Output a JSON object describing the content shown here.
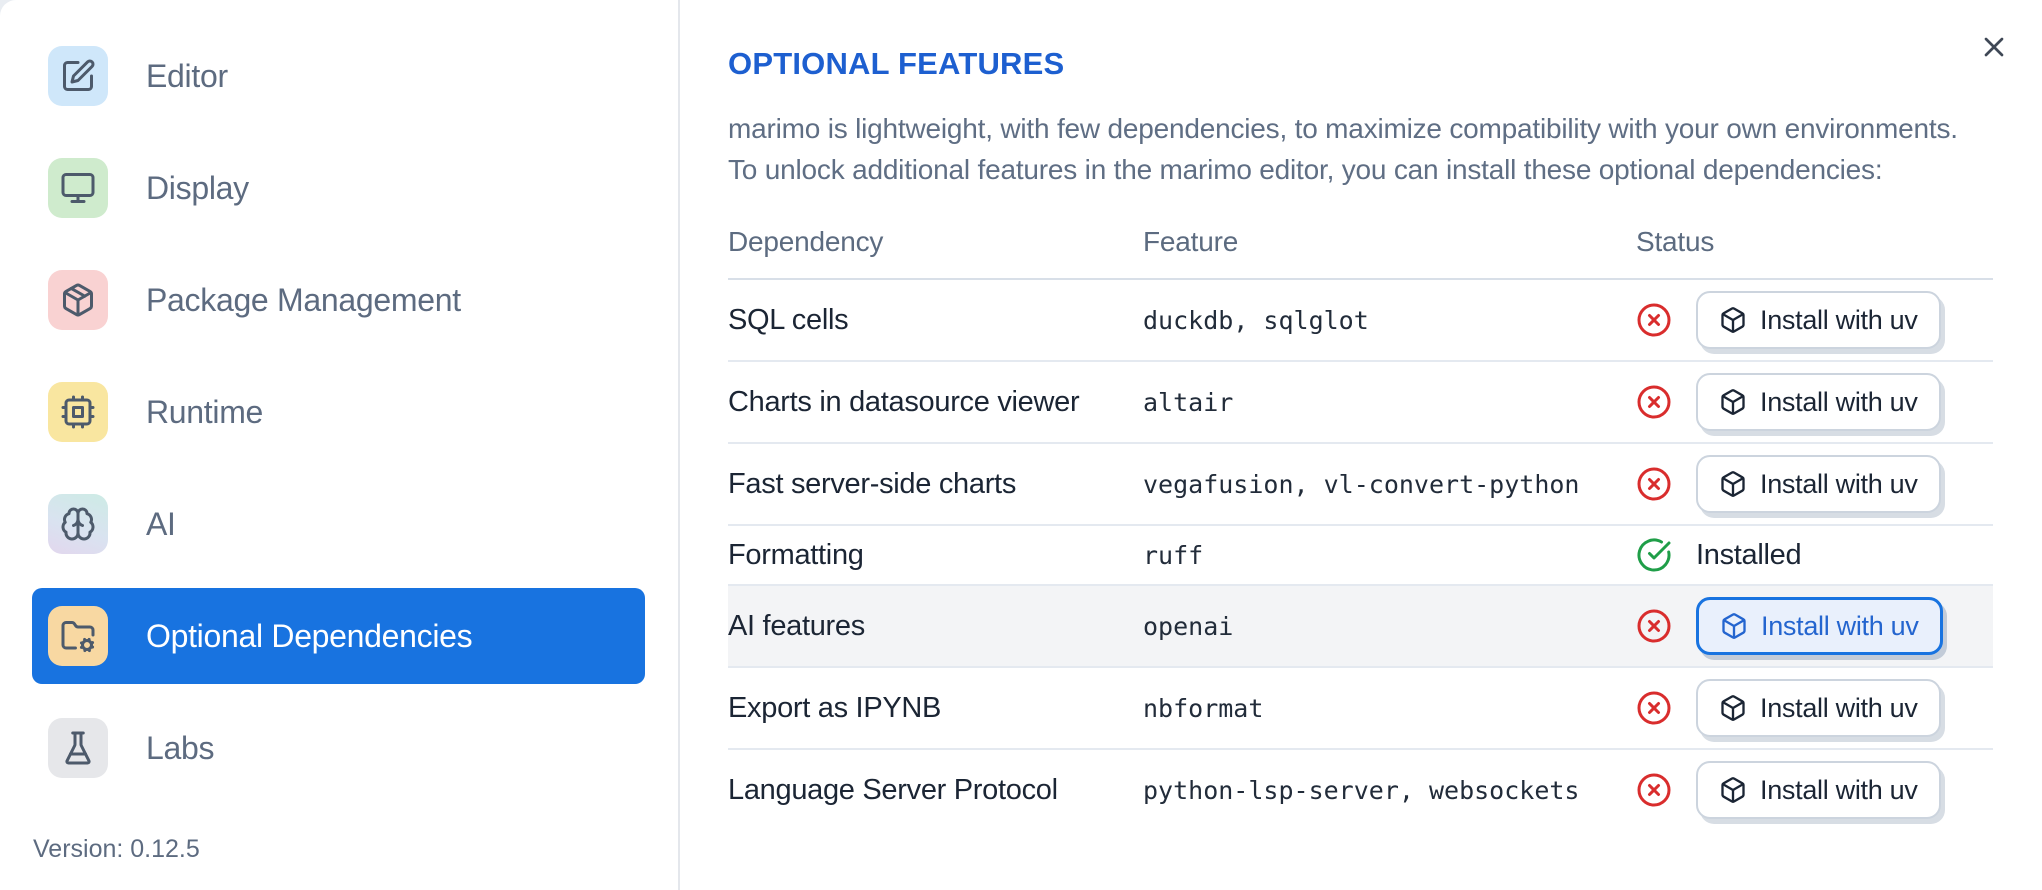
{
  "colors": {
    "accent_blue": "#1873e0",
    "title_blue": "#1d5fd0",
    "status_red": "#d92d2d",
    "status_green": "#1f9e48"
  },
  "sidebar": {
    "items": [
      {
        "label": "Editor",
        "icon": "square-pen-icon",
        "icon_bg": "#cfe7fa",
        "selected": false
      },
      {
        "label": "Display",
        "icon": "monitor-icon",
        "icon_bg": "#cfebcd",
        "selected": false
      },
      {
        "label": "Package Management",
        "icon": "package-icon",
        "icon_bg": "#f9d2d2",
        "selected": false
      },
      {
        "label": "Runtime",
        "icon": "cpu-icon",
        "icon_bg": "#f9e6a0",
        "selected": false
      },
      {
        "label": "AI",
        "icon": "brain-icon",
        "icon_bg": "linear-gradient(200deg, #cdebe5 0%, #d9e3f0 55%, #e2d7ee 100%)",
        "selected": false
      },
      {
        "label": "Optional Dependencies",
        "icon": "folder-cog-icon",
        "icon_bg": "#f8d8a2",
        "selected": true
      },
      {
        "label": "Labs",
        "icon": "flask-icon",
        "icon_bg": "#e6e7ea",
        "selected": false
      }
    ],
    "version": "Version: 0.12.5"
  },
  "header": {
    "title": "OPTIONAL FEATURES"
  },
  "description": {
    "line1": "marimo is lightweight, with few dependencies, to maximize compatibility with your own environments.",
    "line2": "To unlock additional features in the marimo editor, you can install these optional dependencies:"
  },
  "table": {
    "columns": [
      "Dependency",
      "Feature",
      "Status"
    ],
    "install_button_label": "Install with uv",
    "installed_label": "Installed",
    "rows": [
      {
        "dependency": "SQL cells",
        "feature": "duckdb, sqlglot",
        "status": "not-installed",
        "highlighted": false,
        "button_focused": false
      },
      {
        "dependency": "Charts in datasource viewer",
        "feature": "altair",
        "status": "not-installed",
        "highlighted": false,
        "button_focused": false
      },
      {
        "dependency": "Fast server-side charts",
        "feature": "vegafusion, vl-convert-python",
        "status": "not-installed",
        "highlighted": false,
        "button_focused": false
      },
      {
        "dependency": "Formatting",
        "feature": "ruff",
        "status": "installed",
        "highlighted": false,
        "button_focused": false
      },
      {
        "dependency": "AI features",
        "feature": "openai",
        "status": "not-installed",
        "highlighted": true,
        "button_focused": true
      },
      {
        "dependency": "Export as IPYNB",
        "feature": "nbformat",
        "status": "not-installed",
        "highlighted": false,
        "button_focused": false
      },
      {
        "dependency": "Language Server Protocol",
        "feature": "python-lsp-server, websockets",
        "status": "not-installed",
        "highlighted": false,
        "button_focused": false
      }
    ]
  }
}
